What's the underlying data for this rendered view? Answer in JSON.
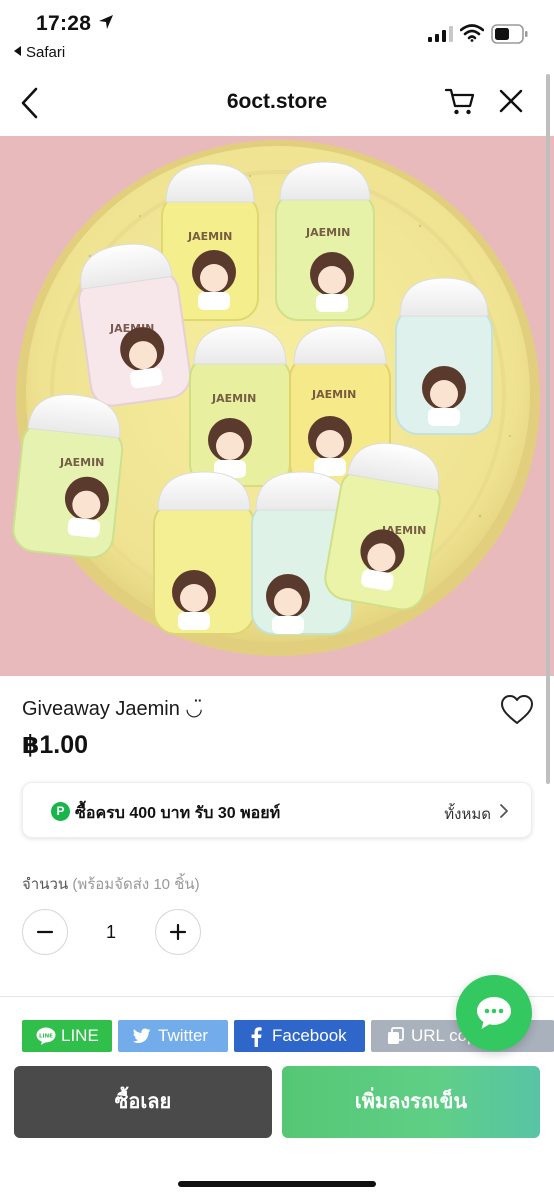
{
  "status_bar": {
    "time": "17:28",
    "back_app": "Safari"
  },
  "nav": {
    "title": "6oct.store"
  },
  "hero": {
    "sticker_text": "JAEMIN"
  },
  "product": {
    "name": "Giveaway Jaemin ◡̈",
    "price": "฿1.00"
  },
  "points": {
    "badge": "P",
    "text": "ซื้อครบ 400 บาท รับ 30 พอยท์",
    "all_label": "ทั้งหมด"
  },
  "quantity": {
    "label": "จำนวน",
    "sub_label": "(พร้อมจัดส่ง 10 ชิ้น)",
    "value": "1"
  },
  "share": {
    "line": "LINE",
    "twitter": "Twitter",
    "facebook": "Facebook",
    "url": "URL copy"
  },
  "actions": {
    "buy_now": "ซื้อเลย",
    "add_to_cart": "เพิ่มลงรถเข็น"
  },
  "colors": {
    "accent_green": "#33c960",
    "buy_dark": "#4a4a4a",
    "line_green": "#2fbf4a",
    "twitter_blue": "#72acea",
    "facebook_blue": "#2f66c9",
    "url_gray": "#a9b1bd"
  },
  "icons": [
    "location-arrow-icon",
    "cellular-signal-icon",
    "wifi-icon",
    "battery-icon",
    "back-chevron-icon",
    "cart-icon",
    "close-icon",
    "heart-icon",
    "chevron-right-icon",
    "minus-icon",
    "plus-icon",
    "line-icon",
    "twitter-bird-icon",
    "facebook-f-icon",
    "copy-icon",
    "chat-bubble-icon"
  ]
}
